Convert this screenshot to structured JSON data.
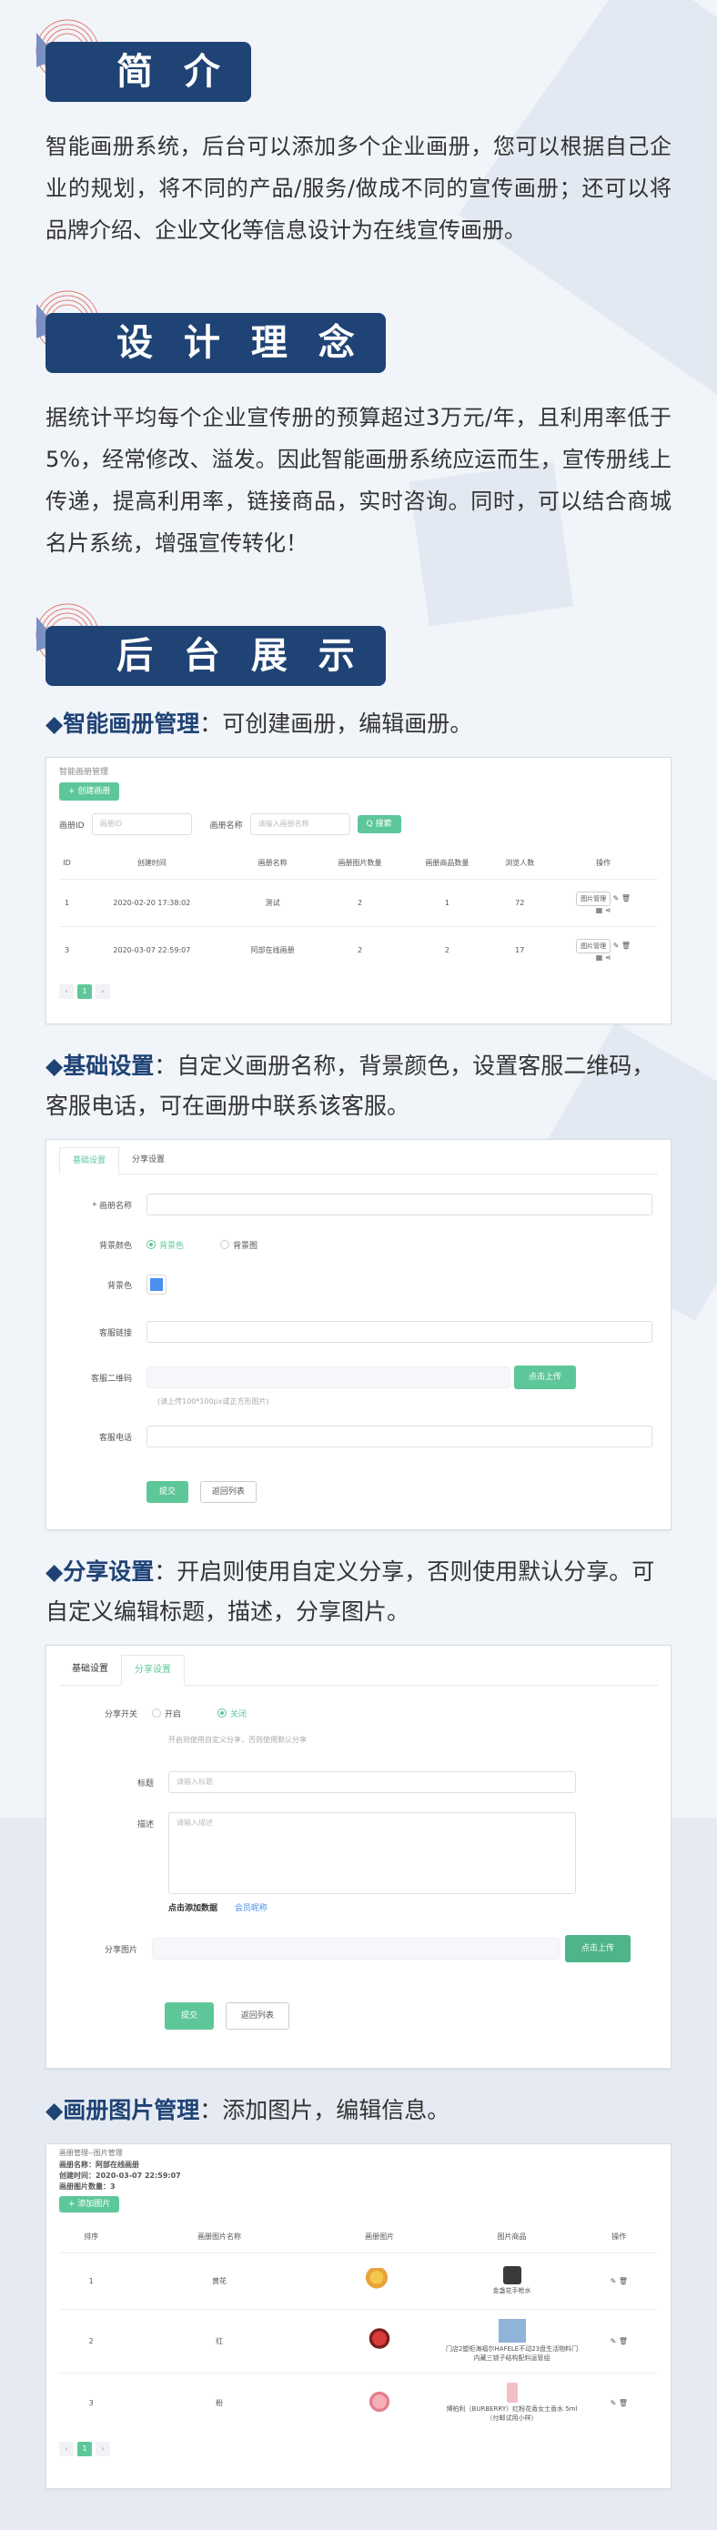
{
  "colors": {
    "navy": "#1f4375",
    "green": "#5ec79a",
    "bg": "#f1f4f9"
  },
  "sections": {
    "intro": {
      "title": "简 介",
      "text": "智能画册系统，后台可以添加多个企业画册，您可以根据自己企业的规划，将不同的产品/服务/做成不同的宣传画册；还可以将品牌介绍、企业文化等信息设计为在线宣传画册。"
    },
    "concept": {
      "title": "设 计 理 念",
      "text": "据统计平均每个企业宣传册的预算超过3万元/年，且利用率低于5%，经常修改、溢发。因此智能画册系统应运而生，宣传册线上传递，提高利用率，链接商品，实时咨询。同时，可以结合商城名片系统，增强宣传转化！"
    },
    "backend": {
      "title": "后 台 展 示"
    }
  },
  "sub1": {
    "strong": "◆智能画册管理",
    "rest": "：可创建画册，编辑画册。"
  },
  "sub2": {
    "strong": "◆基础设置",
    "rest": "：自定义画册名称，背景颜色，设置客服二维码，客服电话，可在画册中联系该客服。"
  },
  "sub3": {
    "strong": "◆分享设置",
    "rest": "：开启则使用自定义分享，否则使用默认分享。可自定义编辑标题，描述，分享图片。"
  },
  "sub4": {
    "strong": "◆画册图片管理",
    "rest": "：添加图片，编辑信息。"
  },
  "album_mgmt": {
    "breadcrumb": "智能画册管理",
    "create_btn": "+ 创建画册",
    "filter_id_label": "画册ID",
    "filter_id_placeholder": "画册ID",
    "filter_name_label": "画册名称",
    "filter_name_placeholder": "请输入画册名称",
    "search_btn": "Q 搜索",
    "columns": [
      "ID",
      "创建时间",
      "画册名称",
      "画册图片数量",
      "画册商品数量",
      "浏览人数",
      "操作"
    ],
    "rows": [
      [
        "1",
        "2020-02-20 17:38:02",
        "测试",
        "2",
        "1",
        "72"
      ],
      [
        "3",
        "2020-03-07 22:59:07",
        "阿部在线画册",
        "2",
        "2",
        "17"
      ]
    ],
    "row_action": "图片管理",
    "page": "1"
  },
  "basic": {
    "tab_basic": "基础设置",
    "tab_share": "分享设置",
    "name_label": "* 画册名称",
    "bg_label": "背景颜色",
    "bg_opt1": "背景色",
    "bg_opt2": "背景图",
    "color_label": "背景色",
    "link_label": "客服链接",
    "qr_label": "客服二维码",
    "upload_btn": "点击上传",
    "qr_hint": "(请上传100*100px或正方形图片)",
    "phone_label": "客服电话",
    "submit_btn": "提交",
    "back_btn": "返回列表"
  },
  "share": {
    "tab_basic": "基础设置",
    "tab_share": "分享设置",
    "switch_label": "分享开关",
    "switch_on": "开启",
    "switch_off": "关闭",
    "switch_hint": "开启则使用自定义分享，否则使用默认分享",
    "title_label": "标题",
    "title_placeholder": "请输入标题",
    "desc_label": "描述",
    "desc_placeholder": "请输入描述",
    "add_data": "点击添加数据",
    "member_nick": "会员昵称",
    "img_label": "分享图片",
    "upload_btn": "点击上传",
    "submit_btn": "提交",
    "back_btn": "返回列表"
  },
  "pics": {
    "breadcrumb": "画册管理--图片管理",
    "album_name": "画册名称：阿部在线画册",
    "created": "创建时间：2020-03-07 22:59:07",
    "count": "画册图片数量：3",
    "add_btn": "+ 添加图片",
    "columns": [
      "排序",
      "画册图片名称",
      "画册图片",
      "图片商品",
      "操作"
    ],
    "rows": [
      {
        "order": "1",
        "name": "黄花",
        "goods": "金盏花手枪水"
      },
      {
        "order": "2",
        "name": "红",
        "goods": "门店2塑柜海福尔HAFELE不动23盘生活物料门内藏三锁子结构配料运管组"
      },
      {
        "order": "3",
        "name": "粉",
        "goods": "博柏利（BURBERRY）红粉花香女士香水 5ml（付邮试用小样）"
      }
    ],
    "page": "1"
  }
}
